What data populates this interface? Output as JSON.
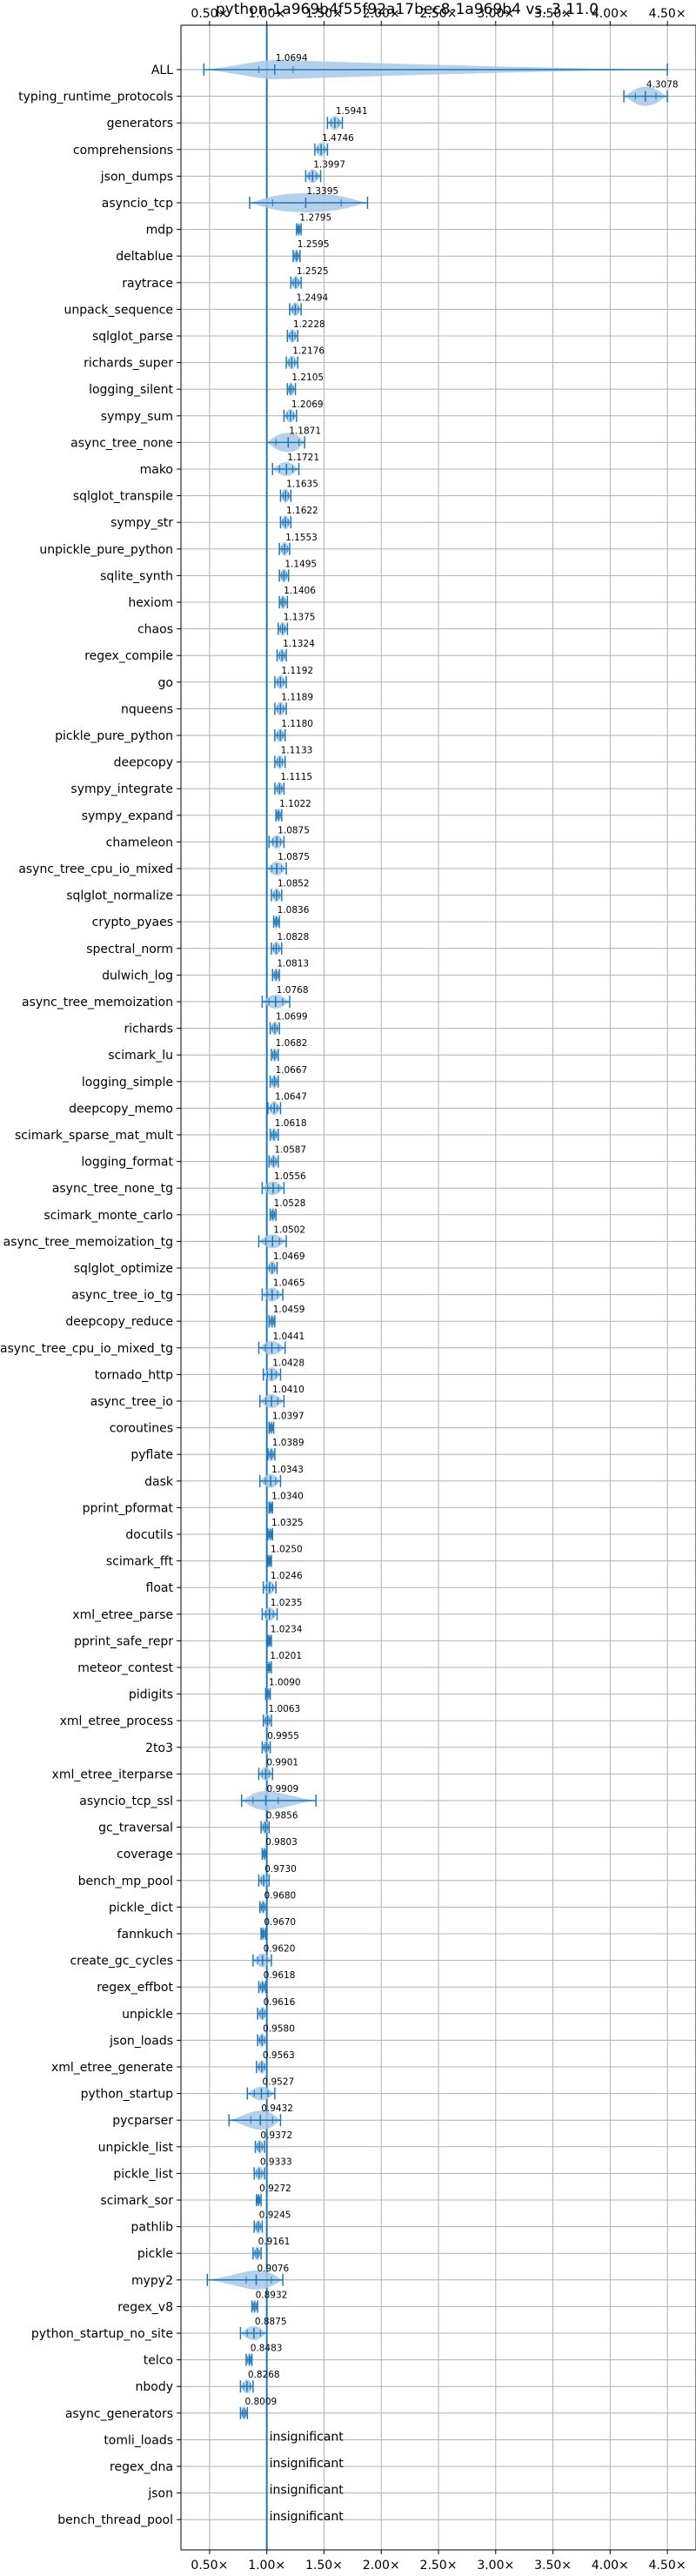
{
  "chart_data": {
    "type": "violin",
    "title": "python-1a969b4f55f92a17bec8-1a969b4 vs. 3.11.0",
    "xlabel": "",
    "ylabel": "",
    "xlim": [
      0.25,
      4.75
    ],
    "x_ticks": [
      0.5,
      1.0,
      1.5,
      2.0,
      2.5,
      3.0,
      3.5,
      4.0,
      4.5
    ],
    "x_tick_labels": [
      "0.50×",
      "1.00×",
      "1.50×",
      "2.00×",
      "2.50×",
      "3.00×",
      "3.50×",
      "4.00×",
      "4.50×"
    ],
    "reference_line": 1.0,
    "grid": true,
    "colors": {
      "violin": "#a8c8e8",
      "stat": "#1f77b4",
      "grid": "#b0b0b0",
      "ref": "#1f77b4"
    },
    "insignificant_text": "insignificant",
    "benchmarks": [
      {
        "name": "ALL",
        "label": "1.0694",
        "min": 0.45,
        "max": 4.5,
        "q1": 0.93,
        "q3": 1.23,
        "spread": 0.15
      },
      {
        "name": "typing_runtime_protocols",
        "label": "4.3078",
        "min": 4.12,
        "max": 4.5,
        "q1": 4.22,
        "q3": 4.4
      },
      {
        "name": "generators",
        "label": "1.5941",
        "min": 1.53,
        "max": 1.66
      },
      {
        "name": "comprehensions",
        "label": "1.4746",
        "min": 1.42,
        "max": 1.53
      },
      {
        "name": "json_dumps",
        "label": "1.3997",
        "min": 1.34,
        "max": 1.47
      },
      {
        "name": "asyncio_tcp",
        "label": "1.3395",
        "min": 0.85,
        "max": 1.88,
        "q1": 1.05,
        "q3": 1.65,
        "spread": 0.35
      },
      {
        "name": "mdp",
        "label": "1.2795",
        "min": 1.26,
        "max": 1.3
      },
      {
        "name": "deltablue",
        "label": "1.2595",
        "min": 1.23,
        "max": 1.29
      },
      {
        "name": "raytrace",
        "label": "1.2525",
        "min": 1.21,
        "max": 1.3
      },
      {
        "name": "unpack_sequence",
        "label": "1.2494",
        "min": 1.2,
        "max": 1.3
      },
      {
        "name": "sqlglot_parse",
        "label": "1.2228",
        "min": 1.18,
        "max": 1.27
      },
      {
        "name": "richards_super",
        "label": "1.2176",
        "min": 1.17,
        "max": 1.27
      },
      {
        "name": "logging_silent",
        "label": "1.2105",
        "min": 1.18,
        "max": 1.25
      },
      {
        "name": "sympy_sum",
        "label": "1.2069",
        "min": 1.15,
        "max": 1.26
      },
      {
        "name": "async_tree_none",
        "label": "1.1871",
        "min": 1.0,
        "max": 1.33,
        "q1": 1.08,
        "q3": 1.28
      },
      {
        "name": "mako",
        "label": "1.1721",
        "min": 1.05,
        "max": 1.28
      },
      {
        "name": "sqlglot_transpile",
        "label": "1.1635",
        "min": 1.12,
        "max": 1.21
      },
      {
        "name": "sympy_str",
        "label": "1.1622",
        "min": 1.12,
        "max": 1.21
      },
      {
        "name": "unpickle_pure_python",
        "label": "1.1553",
        "min": 1.11,
        "max": 1.2
      },
      {
        "name": "sqlite_synth",
        "label": "1.1495",
        "min": 1.11,
        "max": 1.19
      },
      {
        "name": "hexiom",
        "label": "1.1406",
        "min": 1.11,
        "max": 1.18
      },
      {
        "name": "chaos",
        "label": "1.1375",
        "min": 1.1,
        "max": 1.18
      },
      {
        "name": "regex_compile",
        "label": "1.1324",
        "min": 1.09,
        "max": 1.17
      },
      {
        "name": "go",
        "label": "1.1192",
        "min": 1.07,
        "max": 1.17
      },
      {
        "name": "nqueens",
        "label": "1.1189",
        "min": 1.07,
        "max": 1.17
      },
      {
        "name": "pickle_pure_python",
        "label": "1.1180",
        "min": 1.07,
        "max": 1.16
      },
      {
        "name": "deepcopy",
        "label": "1.1133",
        "min": 1.07,
        "max": 1.16
      },
      {
        "name": "sympy_integrate",
        "label": "1.1115",
        "min": 1.07,
        "max": 1.15
      },
      {
        "name": "sympy_expand",
        "label": "1.1022",
        "min": 1.08,
        "max": 1.13
      },
      {
        "name": "chameleon",
        "label": "1.0875",
        "min": 1.02,
        "max": 1.15
      },
      {
        "name": "async_tree_cpu_io_mixed",
        "label": "1.0875",
        "min": 1.0,
        "max": 1.17
      },
      {
        "name": "sqlglot_normalize",
        "label": "1.0852",
        "min": 1.04,
        "max": 1.13
      },
      {
        "name": "crypto_pyaes",
        "label": "1.0836",
        "min": 1.06,
        "max": 1.11
      },
      {
        "name": "spectral_norm",
        "label": "1.0828",
        "min": 1.04,
        "max": 1.13
      },
      {
        "name": "dulwich_log",
        "label": "1.0813",
        "min": 1.05,
        "max": 1.11
      },
      {
        "name": "async_tree_memoization",
        "label": "1.0768",
        "min": 0.96,
        "max": 1.2
      },
      {
        "name": "richards",
        "label": "1.0699",
        "min": 1.03,
        "max": 1.11
      },
      {
        "name": "scimark_lu",
        "label": "1.0682",
        "min": 1.04,
        "max": 1.1
      },
      {
        "name": "logging_simple",
        "label": "1.0667",
        "min": 1.03,
        "max": 1.1
      },
      {
        "name": "deepcopy_memo",
        "label": "1.0647",
        "min": 1.01,
        "max": 1.12
      },
      {
        "name": "scimark_sparse_mat_mult",
        "label": "1.0618",
        "min": 1.03,
        "max": 1.1
      },
      {
        "name": "logging_format",
        "label": "1.0587",
        "min": 1.02,
        "max": 1.1
      },
      {
        "name": "async_tree_none_tg",
        "label": "1.0556",
        "min": 0.96,
        "max": 1.15
      },
      {
        "name": "scimark_monte_carlo",
        "label": "1.0528",
        "min": 1.03,
        "max": 1.08
      },
      {
        "name": "async_tree_memoization_tg",
        "label": "1.0502",
        "min": 0.93,
        "max": 1.17
      },
      {
        "name": "sqlglot_optimize",
        "label": "1.0469",
        "min": 1.0,
        "max": 1.09
      },
      {
        "name": "async_tree_io_tg",
        "label": "1.0465",
        "min": 0.96,
        "max": 1.14
      },
      {
        "name": "deepcopy_reduce",
        "label": "1.0459",
        "min": 1.02,
        "max": 1.07
      },
      {
        "name": "async_tree_cpu_io_mixed_tg",
        "label": "1.0441",
        "min": 0.93,
        "max": 1.16
      },
      {
        "name": "tornado_http",
        "label": "1.0428",
        "min": 0.97,
        "max": 1.12
      },
      {
        "name": "async_tree_io",
        "label": "1.0410",
        "min": 0.94,
        "max": 1.15
      },
      {
        "name": "coroutines",
        "label": "1.0397",
        "min": 1.02,
        "max": 1.06
      },
      {
        "name": "pyflate",
        "label": "1.0389",
        "min": 1.01,
        "max": 1.07
      },
      {
        "name": "dask",
        "label": "1.0343",
        "min": 0.94,
        "max": 1.12
      },
      {
        "name": "pprint_pformat",
        "label": "1.0340",
        "min": 1.02,
        "max": 1.05
      },
      {
        "name": "docutils",
        "label": "1.0325",
        "min": 1.01,
        "max": 1.05
      },
      {
        "name": "scimark_fft",
        "label": "1.0250",
        "min": 1.01,
        "max": 1.04
      },
      {
        "name": "float",
        "label": "1.0246",
        "min": 0.97,
        "max": 1.08
      },
      {
        "name": "xml_etree_parse",
        "label": "1.0235",
        "min": 0.96,
        "max": 1.09
      },
      {
        "name": "pprint_safe_repr",
        "label": "1.0234",
        "min": 1.01,
        "max": 1.04
      },
      {
        "name": "meteor_contest",
        "label": "1.0201",
        "min": 1.0,
        "max": 1.04
      },
      {
        "name": "pidigits",
        "label": "1.0090",
        "min": 0.99,
        "max": 1.03
      },
      {
        "name": "xml_etree_process",
        "label": "1.0063",
        "min": 0.97,
        "max": 1.04
      },
      {
        "name": "2to3",
        "label": "0.9955",
        "min": 0.96,
        "max": 1.03
      },
      {
        "name": "xml_etree_iterparse",
        "label": "0.9901",
        "min": 0.93,
        "max": 1.05
      },
      {
        "name": "asyncio_tcp_ssl",
        "label": "0.9909",
        "min": 0.78,
        "max": 1.43,
        "q1": 0.88,
        "q3": 1.1,
        "spread": 0.25
      },
      {
        "name": "gc_traversal",
        "label": "0.9856",
        "min": 0.95,
        "max": 1.02
      },
      {
        "name": "coverage",
        "label": "0.9803",
        "min": 0.96,
        "max": 1.0
      },
      {
        "name": "bench_mp_pool",
        "label": "0.9730",
        "min": 0.93,
        "max": 1.02
      },
      {
        "name": "pickle_dict",
        "label": "0.9680",
        "min": 0.94,
        "max": 1.0
      },
      {
        "name": "fannkuch",
        "label": "0.9670",
        "min": 0.95,
        "max": 0.99
      },
      {
        "name": "create_gc_cycles",
        "label": "0.9620",
        "min": 0.88,
        "max": 1.04
      },
      {
        "name": "regex_effbot",
        "label": "0.9618",
        "min": 0.93,
        "max": 0.99
      },
      {
        "name": "unpickle",
        "label": "0.9616",
        "min": 0.92,
        "max": 1.0
      },
      {
        "name": "json_loads",
        "label": "0.9580",
        "min": 0.92,
        "max": 1.0
      },
      {
        "name": "xml_etree_generate",
        "label": "0.9563",
        "min": 0.91,
        "max": 1.0
      },
      {
        "name": "python_startup",
        "label": "0.9527",
        "min": 0.83,
        "max": 1.07
      },
      {
        "name": "pycparser",
        "label": "0.9432",
        "min": 0.67,
        "max": 1.12,
        "q1": 0.86,
        "q3": 1.05,
        "spread": 0.15
      },
      {
        "name": "unpickle_list",
        "label": "0.9372",
        "min": 0.9,
        "max": 0.98
      },
      {
        "name": "pickle_list",
        "label": "0.9333",
        "min": 0.89,
        "max": 0.98
      },
      {
        "name": "scimark_sor",
        "label": "0.9272",
        "min": 0.91,
        "max": 0.95
      },
      {
        "name": "pathlib",
        "label": "0.9245",
        "min": 0.89,
        "max": 0.96
      },
      {
        "name": "pickle",
        "label": "0.9161",
        "min": 0.88,
        "max": 0.95
      },
      {
        "name": "mypy2",
        "label": "0.9076",
        "min": 0.48,
        "max": 1.14,
        "q1": 0.82,
        "q3": 1.04,
        "spread": 0.12
      },
      {
        "name": "regex_v8",
        "label": "0.8932",
        "min": 0.87,
        "max": 0.92
      },
      {
        "name": "python_startup_no_site",
        "label": "0.8875",
        "min": 0.77,
        "max": 1.0
      },
      {
        "name": "telco",
        "label": "0.8483",
        "min": 0.82,
        "max": 0.87
      },
      {
        "name": "nbody",
        "label": "0.8268",
        "min": 0.77,
        "max": 0.88
      },
      {
        "name": "async_generators",
        "label": "0.8009",
        "min": 0.77,
        "max": 0.83
      },
      {
        "name": "tomli_loads",
        "insignificant": true
      },
      {
        "name": "regex_dna",
        "insignificant": true
      },
      {
        "name": "json",
        "insignificant": true
      },
      {
        "name": "bench_thread_pool",
        "insignificant": true
      }
    ]
  }
}
